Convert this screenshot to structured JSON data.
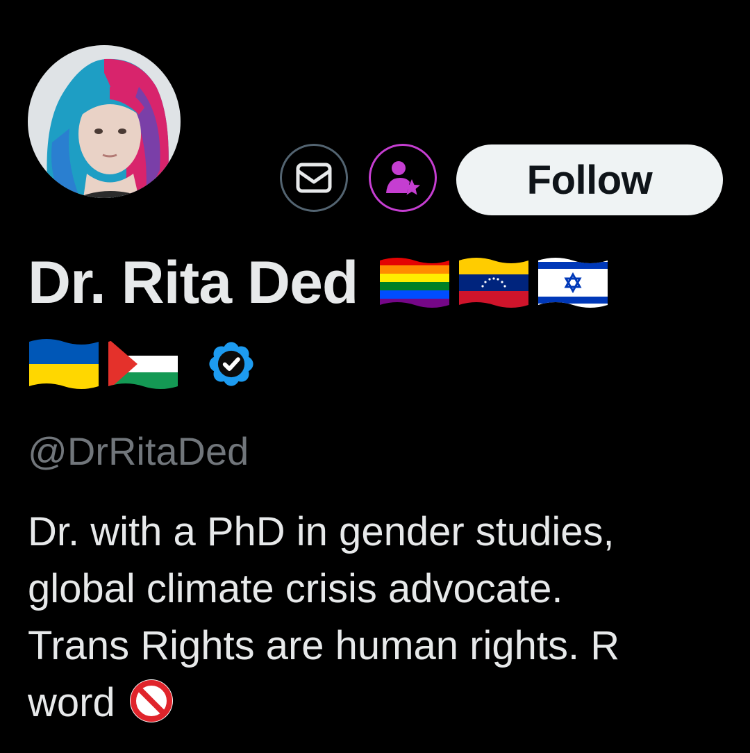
{
  "profile": {
    "display_name": "Dr. Rita Ded",
    "handle": "@DrRitaDed",
    "verified_icon": "verified-badge-icon",
    "name_flags_row1": [
      "rainbow-flag-icon",
      "venezuela-flag-icon",
      "israel-flag-icon"
    ],
    "name_flags_row2": [
      "ukraine-flag-icon",
      "palestine-flag-icon"
    ],
    "bio_lines": [
      "Dr. with a PhD in gender studies,",
      "global climate crisis advocate.",
      "Trans Rights are human rights.  R",
      "word"
    ],
    "bio_trailing_icon": "no-entry-icon"
  },
  "actions": {
    "message_icon": "envelope-icon",
    "subscribe_icon": "person-star-icon",
    "follow_label": "Follow"
  },
  "colors": {
    "background": "#000000",
    "text_primary": "#e7e9ea",
    "text_secondary": "#71767b",
    "follow_bg": "#eff3f4",
    "subscribe_accent": "#c53ed1",
    "verified_blue": "#1d9bf0"
  }
}
